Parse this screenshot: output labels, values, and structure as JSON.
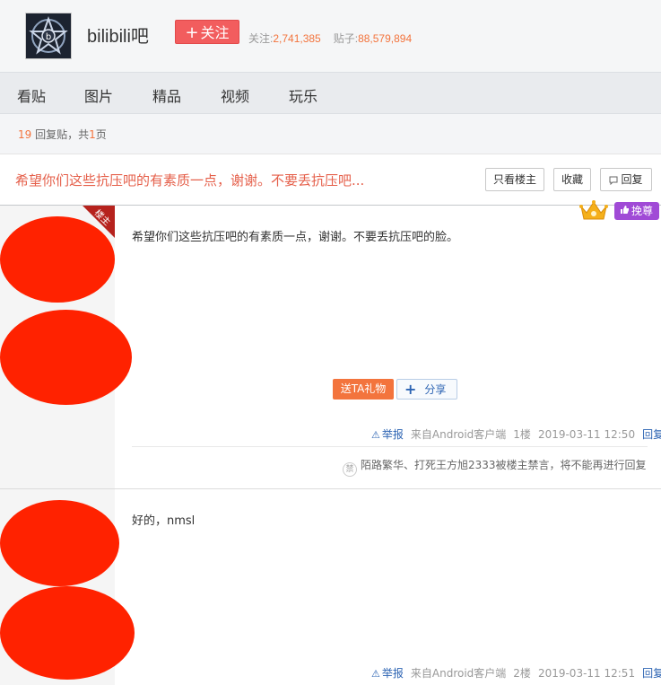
{
  "forum": {
    "name": "bilibili吧",
    "follow_label": "关注",
    "follow_count_label": "关注:",
    "follow_count": "2,741,385",
    "post_count_label": "贴子:",
    "post_count": "88,579,894"
  },
  "nav": {
    "items": [
      "看贴",
      "图片",
      "精品",
      "视频",
      "玩乐"
    ]
  },
  "page_info": {
    "reply_count": "19",
    "reply_label": "回复贴，共",
    "page_count": "1",
    "page_label": "页"
  },
  "thread": {
    "title": "希望你们这些抗压吧的有素质一点，谢谢。不要丢抗压吧...",
    "btn_only_op": "只看楼主",
    "btn_favorite": "收藏",
    "btn_reply": "回复"
  },
  "badge": {
    "paizun_label": "挽尊"
  },
  "posts": [
    {
      "op_badge": "楼主",
      "content": "希望你们这些抗压吧的有素质一点，谢谢。不要丢抗压吧的脸。",
      "gift_label": "送TA礼物",
      "share_label": "分享",
      "report_label": "举报",
      "source": "来自Android客户端",
      "floor": "1楼",
      "time": "2019-03-11 12:50",
      "reply_label": "回复",
      "ban_note": "陌路繁华、打死王方旭2333被楼主禁言，将不能再进行回复",
      "ban_icon": "禁"
    },
    {
      "content": "好的，nmsl",
      "report_label": "举报",
      "source": "来自Android客户端",
      "floor": "2楼",
      "time": "2019-03-11 12:51",
      "reply_label": "回复"
    }
  ],
  "colors": {
    "accent_red": "#f25d5e",
    "title_red": "#e55f4a",
    "number_orange": "#f3743d",
    "link_blue": "#2d64b3",
    "paizun_purple": "#a04ad6",
    "redaction": "#ff2200"
  },
  "icons": {
    "forum_avatar": "star-emblem-icon",
    "reply": "speech-bubble-icon",
    "crown": "crown-icon",
    "report": "warning-triangle-icon",
    "share": "plus-icon",
    "ban": "ban-seal-icon"
  }
}
